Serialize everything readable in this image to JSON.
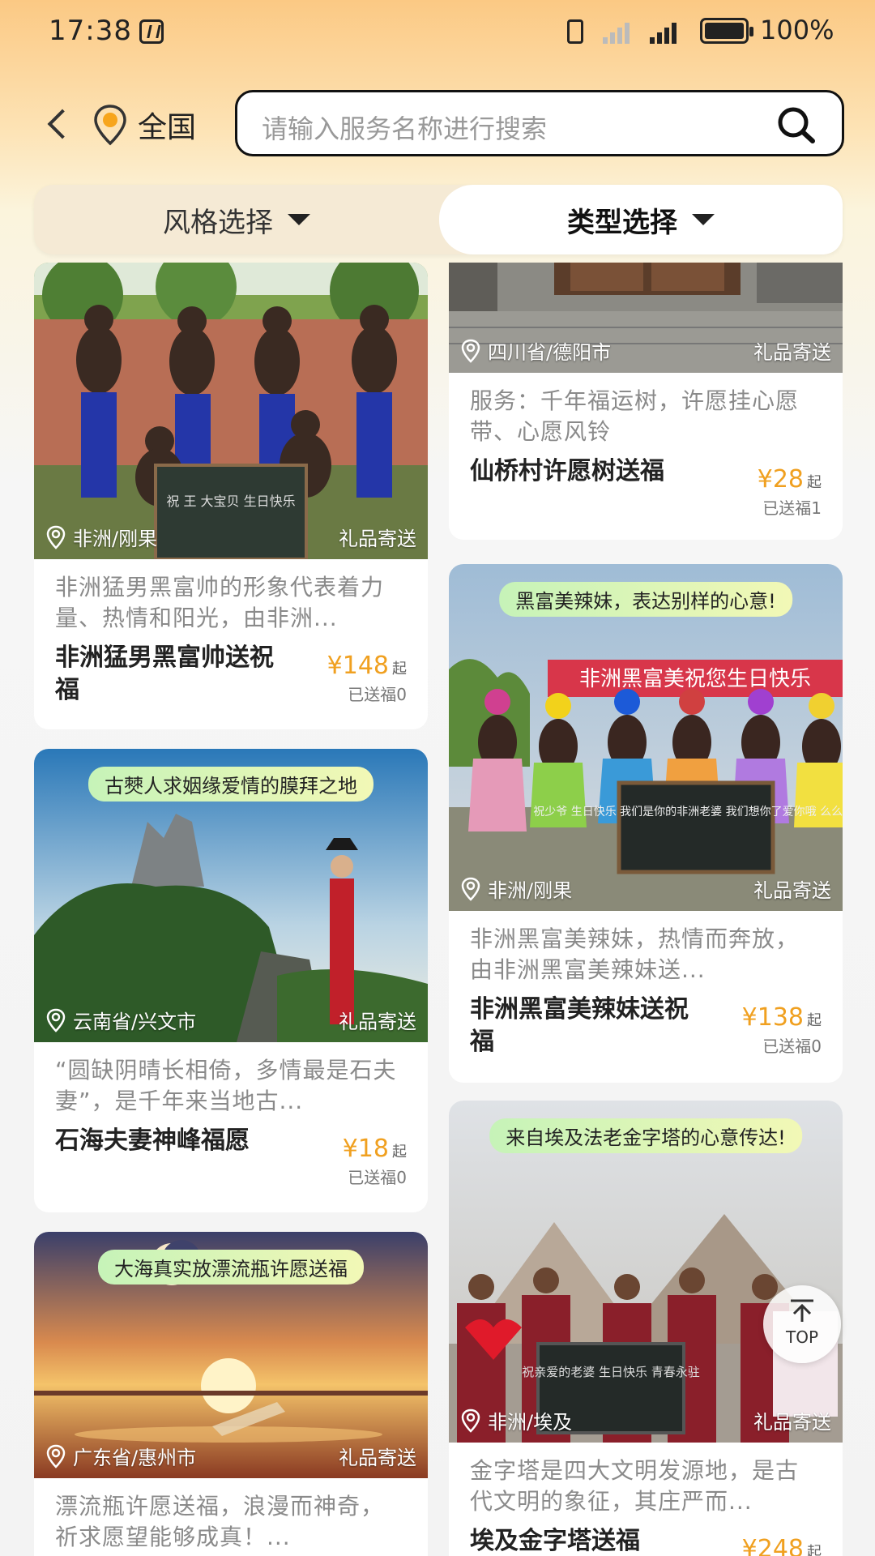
{
  "status_bar": {
    "time": "17:38",
    "battery": "100%"
  },
  "header": {
    "location": "全国",
    "search_placeholder": "请输入服务名称进行搜索"
  },
  "filters": {
    "style": "风格选择",
    "type": "类型选择"
  },
  "cards": [
    {
      "banner": "",
      "location": "非洲/刚果",
      "gift": "礼品寄送",
      "desc": "非洲猛男黑富帅的形象代表着力量、热情和阳光，由非洲...",
      "title": "非洲猛男黑富帅送祝福",
      "price": "¥148",
      "qi": "起",
      "sold": "已送福0"
    },
    {
      "banner": "古僰人求姻缘爱情的膜拜之地",
      "location": "云南省/兴文市",
      "gift": "礼品寄送",
      "desc": "“圆缺阴晴长相倚，多情最是石夫妻”，是千年来当地古...",
      "title": "石海夫妻神峰福愿",
      "price": "¥18",
      "qi": "起",
      "sold": "已送福0"
    },
    {
      "banner": "大海真实放漂流瓶许愿送福",
      "location": "广东省/惠州市",
      "gift": "礼品寄送",
      "desc": "漂流瓶许愿送福，浪漫而神奇，祈求愿望能够成真！...",
      "title": "",
      "price": "",
      "qi": "",
      "sold": ""
    },
    {
      "banner": "",
      "location": "四川省/德阳市",
      "gift": "礼品寄送",
      "desc": "服务：千年福运树，许愿挂心愿带、心愿风铃",
      "title": "仙桥村许愿树送福",
      "price": "¥28",
      "qi": "起",
      "sold": "已送福1"
    },
    {
      "banner": "黑富美辣妹，表达别样的心意!",
      "location": "非洲/刚果",
      "gift": "礼品寄送",
      "desc": "非洲黑富美辣妹，热情而奔放，由非洲黑富美辣妹送...",
      "title": "非洲黑富美辣妹送祝福",
      "price": "¥138",
      "qi": "起",
      "sold": "已送福0"
    },
    {
      "banner": "来自埃及法老金字塔的心意传达!",
      "location": "非洲/埃及",
      "gift": "礼品寄送",
      "desc": "金字塔是四大文明发源地，是古代文明的象征，其庄严而...",
      "title": "埃及金字塔送福",
      "price": "¥248",
      "qi": "起",
      "sold": ""
    }
  ],
  "scenes": {
    "c1_sign": "祝 王    大宝贝 生日快乐",
    "c5_banner": "非洲黑富美祝您生日快乐",
    "c5_sign": "祝少爷 生日快乐 我们是你的非洲老婆 我们想你了爱你哦 么么哒!",
    "c6_sign": "祝亲爱的老婆 生日快乐 青春永驻"
  },
  "top_button": {
    "label": "TOP"
  }
}
